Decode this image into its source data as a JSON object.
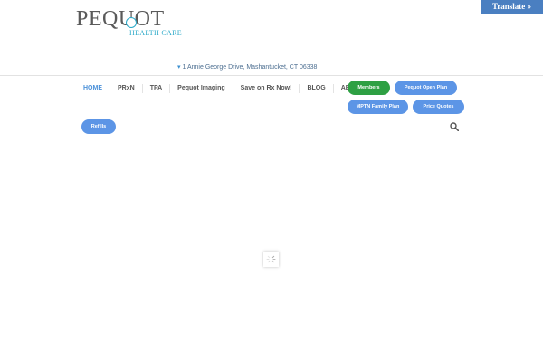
{
  "translate": {
    "label": "Translate »"
  },
  "logo": {
    "word": "PEQUOT",
    "subtitle": "HEALTH CARE"
  },
  "address": "1 Annie George Drive, Mashantucket, CT 06338",
  "nav": {
    "items": [
      {
        "label": "HOME"
      },
      {
        "label": "PRxN"
      },
      {
        "label": "TPA"
      },
      {
        "label": "Pequot Imaging"
      },
      {
        "label": "Save on Rx Now!"
      },
      {
        "label": "BLOG"
      },
      {
        "label": "ABOUT"
      }
    ]
  },
  "buttons": {
    "members": "Members",
    "open_plan": "Pequot Open Plan",
    "family_plan": "MPTN Family Plan",
    "price_quotes": "Price Quotes",
    "refills": "Refills"
  },
  "colors": {
    "accent_blue": "#5c95e6",
    "members_green": "#2ea043",
    "translate_bg": "#4a7fc1"
  }
}
